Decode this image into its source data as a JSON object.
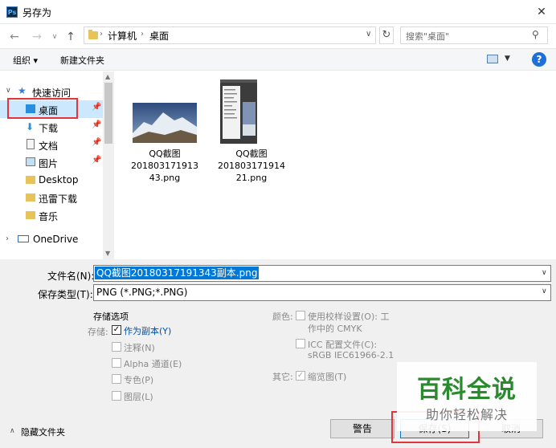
{
  "window": {
    "title": "另存为",
    "app_icon": "Ps",
    "close": "✕"
  },
  "address": {
    "breadcrumbs": [
      "计算机",
      "桌面"
    ],
    "search_placeholder": "搜索\"桌面\""
  },
  "toolbar": {
    "organize": "组织 ▾",
    "new_folder": "新建文件夹",
    "help": "?"
  },
  "nav": {
    "quick_access": "快速访问",
    "items": [
      {
        "label": "桌面",
        "pinned": true
      },
      {
        "label": "下载",
        "pinned": true
      },
      {
        "label": "文档",
        "pinned": true
      },
      {
        "label": "图片",
        "pinned": true
      },
      {
        "label": "Desktop",
        "pinned": false
      },
      {
        "label": "迅雷下载",
        "pinned": false
      },
      {
        "label": "音乐",
        "pinned": false
      }
    ],
    "onedrive": "OneDrive"
  },
  "files": [
    {
      "name_line1": "QQ截图",
      "name_line2": "201803171913",
      "name_line3": "43.png"
    },
    {
      "name_line1": "QQ截图",
      "name_line2": "201803171914",
      "name_line3": "21.png"
    }
  ],
  "form": {
    "filename_label": "文件名(N):",
    "filename_value": "QQ截图20180317191343副本.png",
    "filetype_label": "保存类型(T):",
    "filetype_value": "PNG (*.PNG;*.PNG)"
  },
  "options": {
    "heading": "存储选项",
    "storage_label": "存储:",
    "as_copy": "作为副本(Y)",
    "notes": "注释(N)",
    "alpha": "Alpha 通道(E)",
    "spot": "专色(P)",
    "layers": "图层(L)",
    "color_label": "颜色:",
    "proof_line1": "使用校样设置(O): 工",
    "proof_line2": "作中的 CMYK",
    "icc_line1": "ICC 配置文件(C):",
    "icc_line2": "sRGB IEC61966-2.1",
    "other_label": "其它:",
    "thumbnail": "缩览图(T)"
  },
  "footer": {
    "hide_folders": "隐藏文件夹",
    "warning": "警告",
    "save": "保存(S)",
    "cancel": "取消"
  },
  "watermark": {
    "main": "百科全说",
    "sub": "助你轻松解决"
  }
}
